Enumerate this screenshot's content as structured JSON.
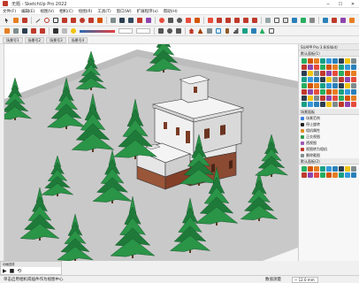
{
  "window": {
    "title": "无题 - SketchUp Pro 2022",
    "controls": [
      "minimize-icon",
      "maximize-icon",
      "close-icon"
    ]
  },
  "menu": [
    "文件(F)",
    "编辑(E)",
    "视图(V)",
    "相机(C)",
    "绘图(R)",
    "工具(T)",
    "窗口(W)",
    "扩展程序(x)",
    "帮助(H)"
  ],
  "scene_tabs": [
    "场景号1",
    "场景号2",
    "场景号3",
    "场景号4"
  ],
  "tray": {
    "title": "SUAPP Pro 3.6(64bit)",
    "panel_library": "默认面板(1)",
    "panel_scenes": "场景面板",
    "panel_bottom": "默认面板(2)",
    "items": [
      {
        "label": "场景范例",
        "icon": "scene-icon",
        "color": "#3b7dd8"
      },
      {
        "label": "停止旋转",
        "icon": "stop-icon",
        "color": "#222222"
      },
      {
        "label": "相机属性",
        "icon": "camera-icon",
        "color": "#e08a1e"
      },
      {
        "label": "正交视图",
        "icon": "ortho-icon",
        "color": "#2e9b4f"
      },
      {
        "label": "透视图",
        "icon": "perspective-icon",
        "color": "#9b59b6"
      },
      {
        "label": "视图转为相机",
        "icon": "view-camera-icon",
        "color": "#c0392b"
      },
      {
        "label": "删除截图",
        "icon": "delete-icon",
        "color": "#7f8c8d"
      }
    ]
  },
  "ruby": {
    "title": "动画插件",
    "controls": [
      "play-icon",
      "stop-icon",
      "loop-icon"
    ]
  },
  "status": {
    "hint": "单击启用相机或插件作为视图中心",
    "measure_label": "数值测量",
    "measure_value": "~ 12.0 mm"
  }
}
